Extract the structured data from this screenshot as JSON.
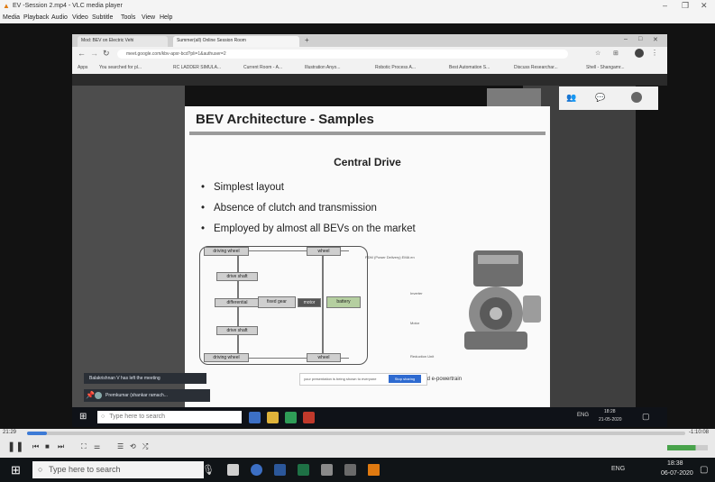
{
  "vlc": {
    "title": "EV -Session 2.mp4 - VLC media player",
    "menu": [
      "Media",
      "Playback",
      "Audio",
      "Video",
      "Subtitle",
      "Tools",
      "View",
      "Help"
    ],
    "time_elapsed": "21:29",
    "time_total": "-1:10:08",
    "progress_fraction": 0.03
  },
  "browser": {
    "tab_1": "Mod: BEV on Electric Vehi",
    "tab_2": "Summer(all) Online Session Room",
    "url": "meet.google.com/kbv-apxr-bcd?pli=1&authuser=2",
    "bookmarks": [
      "Apps",
      "You searched for pl...",
      "RC LADDER SIMULA...",
      "Current Room - A...",
      "Illustration Anyo...",
      "Robotic Process A...",
      "Best Automation S...",
      "Discuss Researchar...",
      "Shell - Shangamr..."
    ]
  },
  "slide": {
    "title": "BEV Architecture - Samples",
    "subtitle": "Central Drive",
    "bullets": [
      "Simplest layout",
      "Absence of clutch and transmission",
      "Employed by almost all BEVs on the market"
    ],
    "diagram": {
      "driving_wheel_top": "driving wheel",
      "wheel_top": "wheel",
      "drive_shaft_top": "drive shaft",
      "differential": "differential",
      "fixed_gear": "fixed gear",
      "motor": "motor",
      "battery": "battery",
      "drive_shaft_bottom": "drive shaft",
      "driving_wheel_bottom": "driving wheel",
      "wheel_bottom": "wheel"
    },
    "motor_labels": [
      "PDM (Power Delivery) EMA en",
      "Inverter",
      "Motor",
      "Reduction Unit"
    ],
    "footer": "grated e-powertrain"
  },
  "meet": {
    "present_bar": "your presentation is being shown to everyone",
    "stop_button": "Stop sharing",
    "left_meeting": "Balakrishnan V has left the meeting",
    "presenting": "Premkumar (shankar ramach..."
  },
  "inner_taskbar": {
    "search_placeholder": "Type here to search",
    "lang": "ENG",
    "time": "18:28",
    "date": "21-05-2020"
  },
  "taskbar": {
    "search_placeholder": "Type here to search",
    "lang": "ENG",
    "time": "18:38",
    "date": "06-07-2020"
  }
}
